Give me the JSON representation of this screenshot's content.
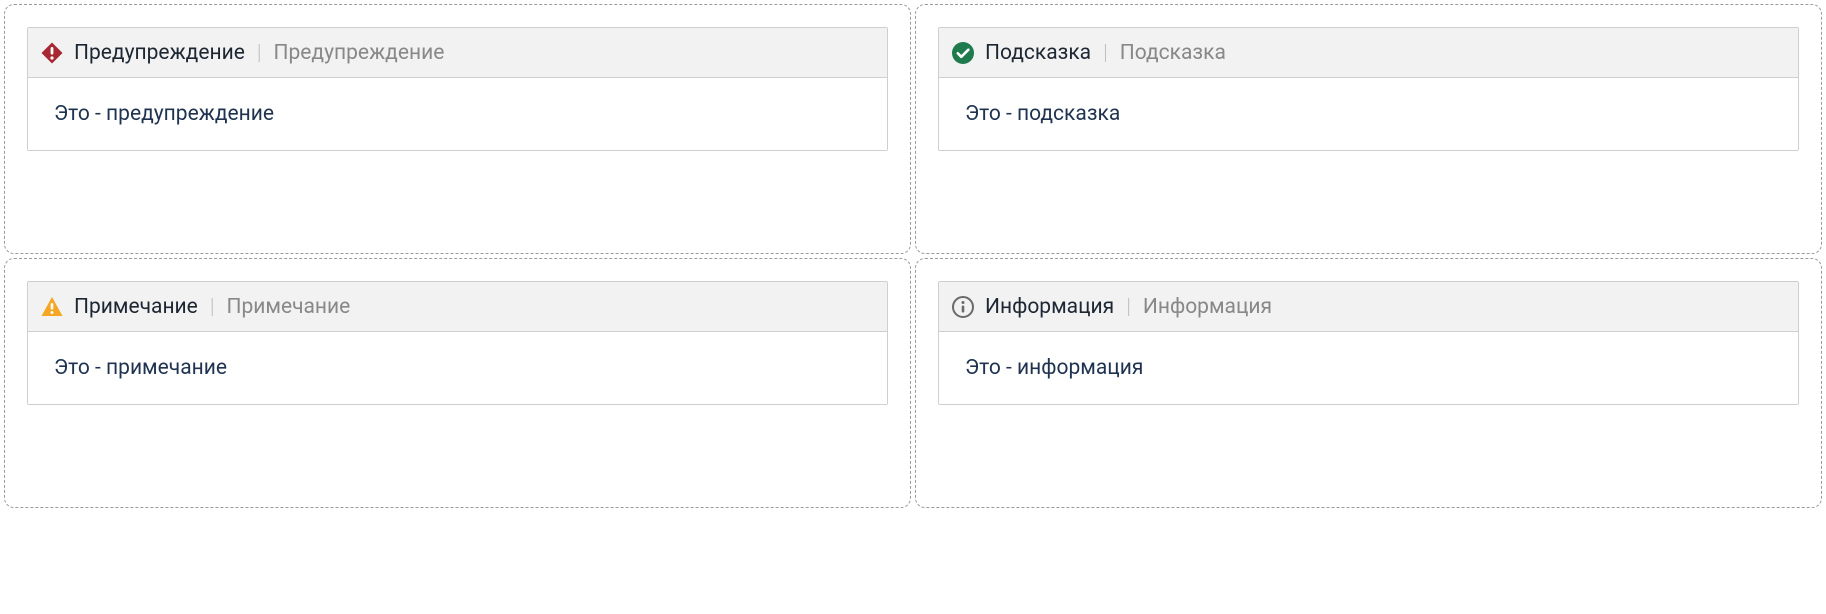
{
  "icons": {
    "warning": "warning-icon",
    "tip": "check-circle-icon",
    "note": "alert-triangle-icon",
    "info": "info-circle-icon"
  },
  "colors": {
    "warning_icon": "#a72832",
    "tip_icon": "#1f7a4d",
    "note_icon": "#f5a623",
    "info_icon": "#6a6a6a",
    "body_text": "#1f3350",
    "subtitle_text": "#888888",
    "panel_border": "#cfcfcf",
    "cell_border": "#9b9b9b"
  },
  "panels": {
    "warning": {
      "title": "Предупреждение",
      "subtitle": "Предупреждение",
      "body": "Это - предупреждение"
    },
    "tip": {
      "title": "Подсказка",
      "subtitle": "Подсказка",
      "body": "Это - подсказка"
    },
    "note": {
      "title": "Примечание",
      "subtitle": "Примечание",
      "body": "Это - примечание"
    },
    "info": {
      "title": "Информация",
      "subtitle": "Информация",
      "body": "Это - информация"
    }
  }
}
